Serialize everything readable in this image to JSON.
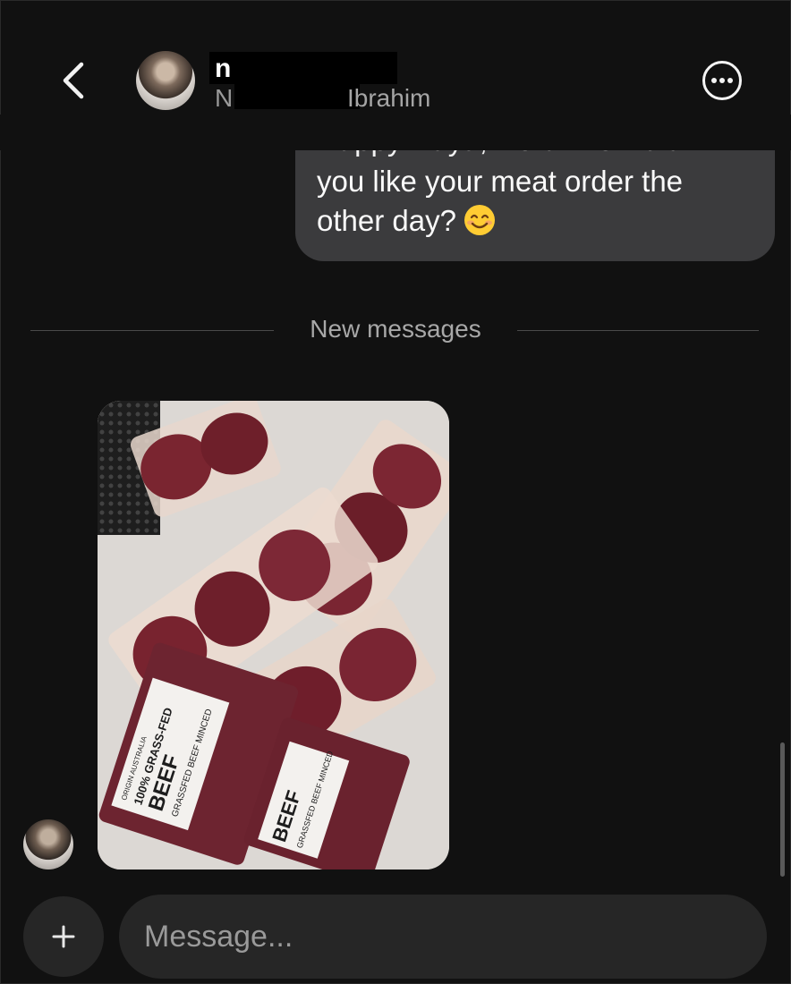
{
  "header": {
    "name_visible": "n",
    "subtitle_visible_start": "N",
    "subtitle_visible_end": "Ibrahim",
    "back_icon": "chevron-left-icon",
    "more_icon": "more-horizontal-icon"
  },
  "thread": {
    "sent_message": {
      "cutoff_line": "Happy Raya, Nora! How did",
      "line_1": "you like your meat order the",
      "line_2": "other day?",
      "emoji": "smiling-face-emoji"
    },
    "divider_label": "New messages",
    "received_photo": {
      "label_large_1": "100% GRASS-FED",
      "label_large_2": "BEEF",
      "label_sub_1": "GRASSFED BEEF MINCED",
      "label_large_3": "BEEF",
      "label_sub_2": "GRASSFED BEEF MINCED",
      "label_origin": "ORIGIN AUSTRALIA"
    }
  },
  "composer": {
    "add_icon": "plus-icon",
    "placeholder": "Message..."
  },
  "colors": {
    "background": "#111111",
    "bubble_sent": "#3b3b3d",
    "input_bg": "#262626"
  }
}
